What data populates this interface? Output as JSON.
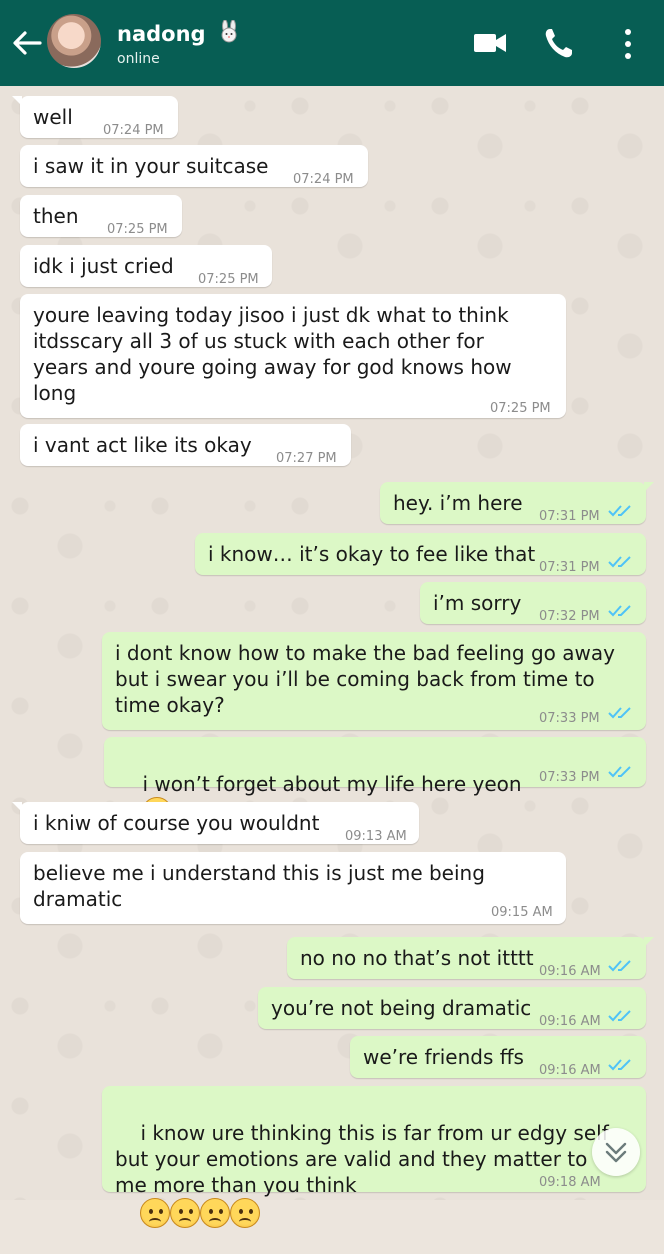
{
  "header": {
    "contact_name": "nadong",
    "status": "online",
    "name_emoji": "rabbit-face-emoji",
    "bar_color": "#075e54",
    "icons": [
      "back-arrow-icon",
      "video-call-icon",
      "voice-call-icon",
      "more-options-icon"
    ]
  },
  "colors": {
    "incoming_bubble": "#ffffff",
    "outgoing_bubble": "#dcf8c6",
    "read_ticks": "#4fc3f7",
    "chat_background": "#e9e2da"
  },
  "messages": [
    {
      "direction": "in",
      "text": "well",
      "time": "07:24 PM"
    },
    {
      "direction": "in",
      "text": "i saw it in your suitcase",
      "time": "07:24 PM"
    },
    {
      "direction": "in",
      "text": "then",
      "time": "07:25 PM"
    },
    {
      "direction": "in",
      "text": "idk i just cried",
      "time": "07:25 PM"
    },
    {
      "direction": "in",
      "text": "youre leaving today jisoo i just dk what to think itdsscary all 3 of us stuck with each other for years and youre going away for god knows how long",
      "time": "07:25 PM"
    },
    {
      "direction": "in",
      "text": "i vant act like its okay",
      "time": "07:27 PM"
    },
    {
      "direction": "out",
      "text": "hey. i’m here",
      "time": "07:31 PM",
      "read": true
    },
    {
      "direction": "out",
      "text": "i know… it’s okay to fee like that",
      "time": "07:31 PM",
      "read": true
    },
    {
      "direction": "out",
      "text": "i’m sorry",
      "time": "07:32 PM",
      "read": true
    },
    {
      "direction": "out",
      "text": "i dont know how to make the bad feeling go away but i swear you i’ll be coming back from time to time okay?",
      "time": "07:33 PM",
      "read": true
    },
    {
      "direction": "out",
      "text": "i won’t forget about my life here yeon",
      "time": "07:33 PM",
      "read": true,
      "emoji": [
        "frowning-face-emoji"
      ]
    },
    {
      "direction": "in",
      "text": "i kniw of course you wouldnt",
      "time": "09:13 AM"
    },
    {
      "direction": "in",
      "text": "believe me i understand this is just me being dramatic",
      "time": "09:15 AM"
    },
    {
      "direction": "out",
      "text": "no no no that’s not itttt",
      "time": "09:16 AM",
      "read": true
    },
    {
      "direction": "out",
      "text": "you’re not being dramatic",
      "time": "09:16 AM",
      "read": true
    },
    {
      "direction": "out",
      "text": "we’re friends ffs",
      "time": "09:16 AM",
      "read": true
    },
    {
      "direction": "out",
      "text": "i know ure thinking this is far from ur edgy self but your emotions are valid and they matter to me more than you think",
      "time": "09:18 AM",
      "read": true,
      "emoji": [
        "frowning-face-emoji",
        "frowning-face-emoji",
        "frowning-face-emoji",
        "frowning-face-emoji"
      ]
    }
  ],
  "scroll_button_icon": "chevron-double-down-icon"
}
